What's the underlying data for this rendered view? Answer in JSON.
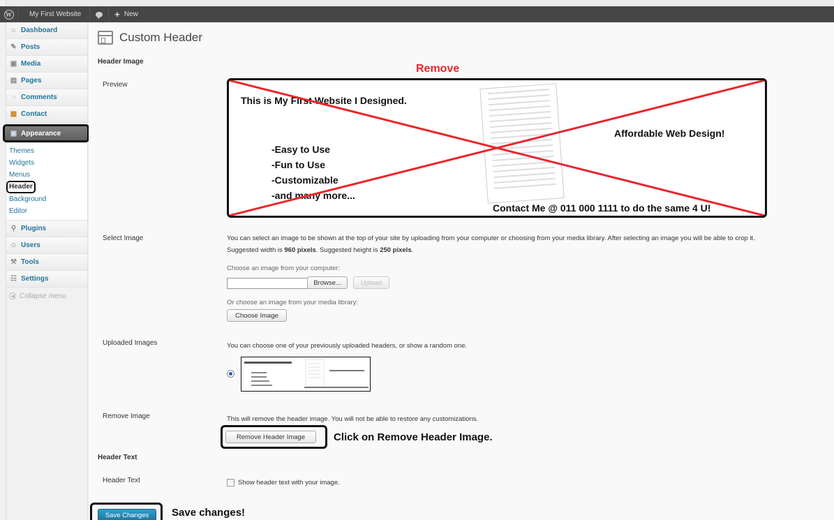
{
  "admin_bar": {
    "site_name": "My First Website",
    "new_label": "New"
  },
  "sidebar": {
    "items_top": [
      {
        "label": "Dashboard",
        "icon": "home-icon"
      },
      {
        "label": "Posts",
        "icon": "pin-icon"
      },
      {
        "label": "Media",
        "icon": "media-icon"
      },
      {
        "label": "Pages",
        "icon": "page-icon"
      },
      {
        "label": "Comments",
        "icon": "comment-icon"
      },
      {
        "label": "Contact",
        "icon": "contact-icon"
      }
    ],
    "appearance": "Appearance",
    "submenu": [
      "Themes",
      "Widgets",
      "Menus",
      "Header",
      "Background",
      "Editor"
    ],
    "items_bottom": [
      {
        "label": "Plugins",
        "icon": "plugin-icon"
      },
      {
        "label": "Users",
        "icon": "users-icon"
      },
      {
        "label": "Tools",
        "icon": "tools-icon"
      },
      {
        "label": "Settings",
        "icon": "settings-icon"
      }
    ],
    "collapse": "Collapse menu"
  },
  "page": {
    "title": "Custom Header",
    "header_image_heading": "Header Image",
    "preview_label": "Preview",
    "remove_annotation": "Remove",
    "preview_image": {
      "line1": "This is My First Website I Designed.",
      "tagline": "Affordable Web Design!",
      "bullets": [
        "-Easy to Use",
        "-Fun to Use",
        "-Customizable",
        "-and many more..."
      ],
      "contact": "Contact Me @ 011 000 1111 to do the same 4 U!"
    },
    "select_image_label": "Select Image",
    "select_desc": "You can select an image to be shown at the top of your site by uploading from your computer or choosing from your media library. After selecting an image you will be able to crop it.",
    "suggested_prefix": "Suggested width is ",
    "suggested_width": "960 pixels",
    "suggested_mid": ". Suggested height is ",
    "suggested_height": "250 pixels",
    "suggested_suffix": ".",
    "choose_computer": "Choose an image from your computer:",
    "browse_button": "Browse...",
    "upload_button": "Upload",
    "choose_library": "Or choose an image from your media library:",
    "choose_image_button": "Choose Image",
    "uploaded_label": "Uploaded Images",
    "uploaded_desc": "You can choose one of your previously uploaded headers, or show a random one.",
    "remove_image_label": "Remove Image",
    "remove_desc": "This will remove the header image. You will not be able to restore any customizations.",
    "remove_button": "Remove Header Image",
    "remove_instruction": "Click on Remove Header Image.",
    "header_text_heading": "Header Text",
    "header_text_label": "Header Text",
    "show_header_text": "Show header text with your image.",
    "save_button": "Save Changes",
    "save_instruction": "Save changes!"
  },
  "colors": {
    "link": "#21759b",
    "admin_bar": "#464646",
    "remove_cross": "#e8262b",
    "primary_button": "#21759b"
  }
}
